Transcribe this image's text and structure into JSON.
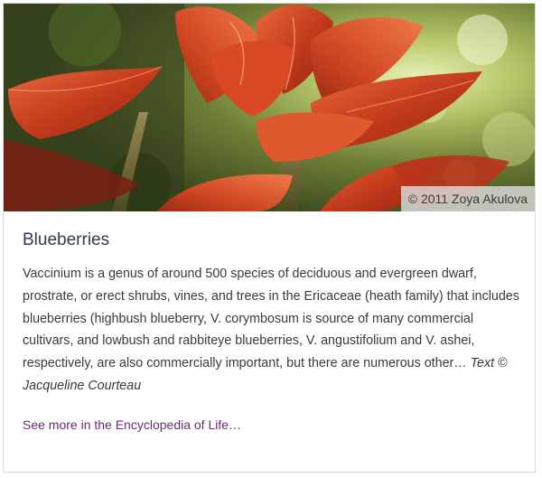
{
  "card": {
    "image": {
      "subject": "red-leaf-plant-photo",
      "credit": "© 2011 Zoya Akulova"
    },
    "title": "Blueberries",
    "description": "Vaccinium is a genus of around 500 species of deciduous and evergreen dwarf, prostrate, or erect shrubs, vines, and trees in the Ericaceae (heath family) that includes blueberries (highbush blueberry, V. corymbosum is source of many commercial cultivars, and lowbush and rabbiteye blueberries, V. angustifolium and V. ashei, respectively, are also commercially important, but there are numerous other…",
    "attribution": "Text © Jacqueline Courteau",
    "link_label": "See more in the Encyclopedia of Life…"
  },
  "colors": {
    "title": "#2f3c4c",
    "body_text": "#3a3a3a",
    "link": "#6b2a73",
    "leaf_red": "#c63a1c"
  }
}
